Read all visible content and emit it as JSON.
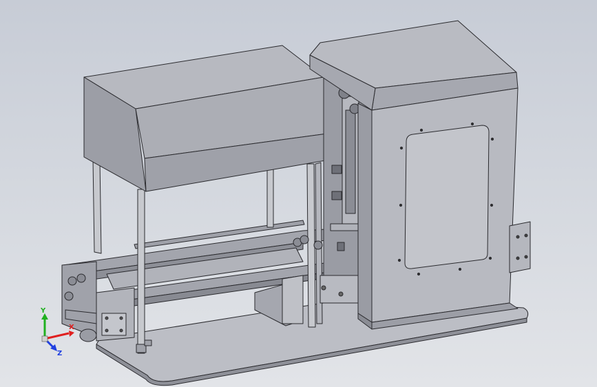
{
  "triad": {
    "x_label": "X",
    "y_label": "Y",
    "z_label": "Z",
    "colors": {
      "x": "#e02020",
      "y": "#20b020",
      "z": "#2040e0"
    }
  },
  "model": {
    "body_color": "#a8aab3",
    "shade_color": "#8f919a",
    "edge_color": "#2a2a2e"
  }
}
